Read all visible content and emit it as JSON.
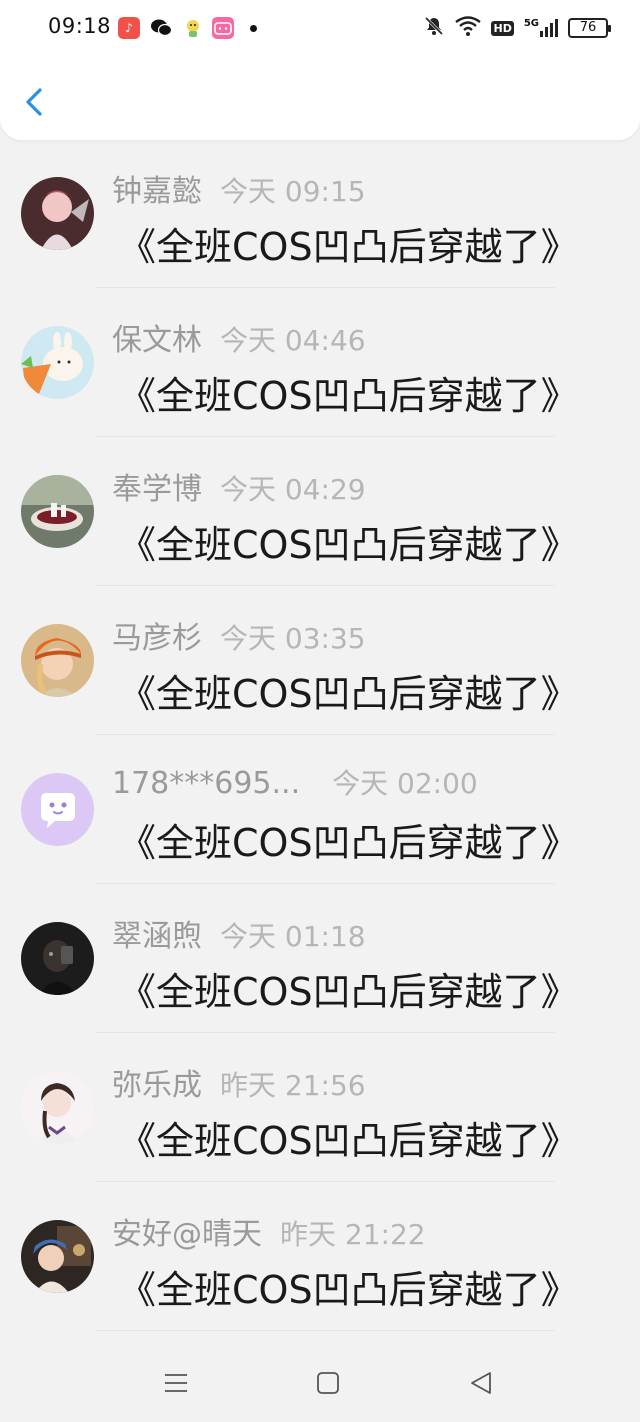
{
  "status_bar": {
    "time": "09:18",
    "battery": "76",
    "notification_icons": [
      "music-app-icon",
      "wechat-icon",
      "mascot-app-icon",
      "bilibili-icon"
    ],
    "system_icons": [
      "mute-icon",
      "wifi-icon",
      "hd-icon",
      "signal-5g-icon",
      "battery-icon"
    ],
    "hd_label": "HD",
    "signal_label": "5G"
  },
  "header": {
    "back_icon": "chevron-left-icon",
    "accent_color": "#2b8fe6"
  },
  "messages": [
    {
      "name": "钟嘉懿",
      "time": "今天 09:15",
      "text": "《全班COS凹凸后穿越了》"
    },
    {
      "name": "保文林",
      "time": "今天 04:46",
      "text": "《全班COS凹凸后穿越了》"
    },
    {
      "name": "奉学博",
      "time": "今天 04:29",
      "text": "《全班COS凹凸后穿越了》"
    },
    {
      "name": "马彦杉",
      "time": "今天 03:35",
      "text": "《全班COS凹凸后穿越了》"
    },
    {
      "name": "178***695...",
      "time": "今天 02:00",
      "text": "《全班COS凹凸后穿越了》"
    },
    {
      "name": "翠涵煦",
      "time": "今天 01:18",
      "text": "《全班COS凹凸后穿越了》"
    },
    {
      "name": "弥乐成",
      "time": "昨天 21:56",
      "text": "《全班COS凹凸后穿越了》"
    },
    {
      "name": "安好@晴天",
      "time": "昨天 21:22",
      "text": "《全班COS凹凸后穿越了》"
    }
  ],
  "nav_bar": {
    "icons": [
      "menu-icon",
      "home-icon",
      "back-triangle-icon"
    ]
  }
}
